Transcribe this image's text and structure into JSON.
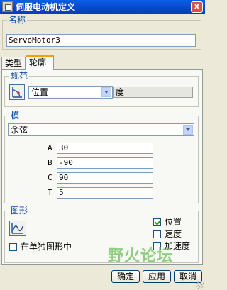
{
  "window": {
    "title": "伺服电动机定义",
    "close_label": "X"
  },
  "name": {
    "legend": "名称",
    "value": "ServoMotor3"
  },
  "tabs": [
    {
      "label": "类型"
    },
    {
      "label": "轮廓"
    }
  ],
  "spec": {
    "legend": "规范",
    "quantity": "位置",
    "unit": "度"
  },
  "mode": {
    "legend": "模",
    "function": "余弦",
    "params": [
      {
        "label": "A",
        "value": "30"
      },
      {
        "label": "B",
        "value": "-90"
      },
      {
        "label": "C",
        "value": "90"
      },
      {
        "label": "T",
        "value": "5"
      }
    ]
  },
  "graph": {
    "legend": "图形",
    "separate_label": "在单独图形中",
    "separate_checked": false,
    "options": [
      {
        "label": "位置",
        "checked": true
      },
      {
        "label": "速度",
        "checked": false
      },
      {
        "label": "加速度",
        "checked": false
      }
    ]
  },
  "watermark": "野火论坛",
  "buttons": {
    "ok": "确定",
    "apply": "应用",
    "cancel": "取消"
  },
  "icons": [
    "app-icon",
    "close-icon",
    "position-spec-icon",
    "graph-icon",
    "chevron-down-icon"
  ]
}
